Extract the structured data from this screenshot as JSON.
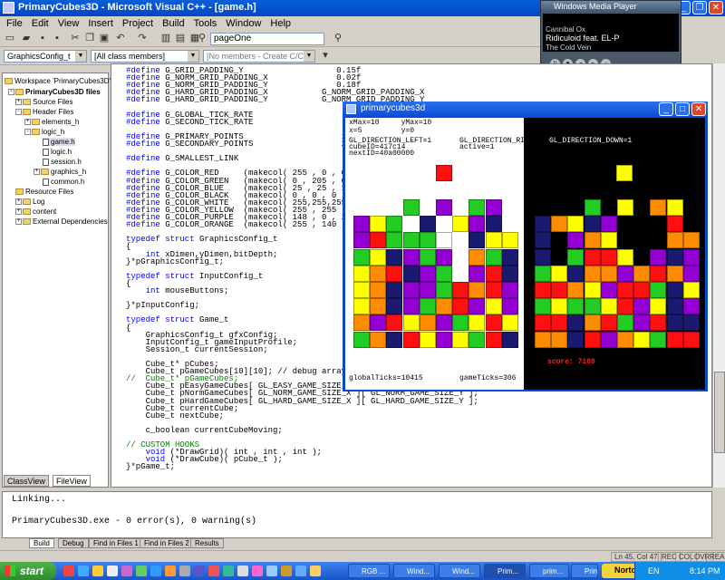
{
  "window": {
    "title": "PrimaryCubes3D - Microsoft Visual C++ - [game.h]"
  },
  "menu": [
    "File",
    "Edit",
    "View",
    "Insert",
    "Project",
    "Build",
    "Tools",
    "Window",
    "Help"
  ],
  "toolbar": {
    "page_combo": "pageOne"
  },
  "toolbar2": {
    "class_combo": "GraphicsConfig_t",
    "members_combo": "[All class members]",
    "function_combo": "[No members - Create C/C++ Member Function..."
  },
  "media_player": {
    "title": "Windows Media Player",
    "line1": "Cannibal Ox",
    "line2": "Ridiculoid feat. EL-P",
    "line3": "The Cold Vein"
  },
  "workspace": {
    "items": [
      {
        "label": "Workspace 'PrimaryCubes3D':",
        "icon": "workspace-icon"
      },
      {
        "label": "PrimaryCubes3D files",
        "icon": "project-icon"
      },
      {
        "label": "Source Files",
        "icon": "folder-icon"
      },
      {
        "label": "Header Files",
        "icon": "folder-icon"
      },
      {
        "label": "elements_h",
        "icon": "folder-icon"
      },
      {
        "label": "logic_h",
        "icon": "folder-icon"
      },
      {
        "label": "game.h",
        "icon": "file-icon"
      },
      {
        "label": "logic.h",
        "icon": "file-icon"
      },
      {
        "label": "session.h",
        "icon": "file-icon"
      },
      {
        "label": "graphics_h",
        "icon": "folder-icon"
      },
      {
        "label": "common.h",
        "icon": "file-icon"
      },
      {
        "label": "Resource Files",
        "icon": "folder-icon"
      },
      {
        "label": "Log",
        "icon": "folder-icon"
      },
      {
        "label": "content",
        "icon": "folder-icon"
      },
      {
        "label": "External Dependencies",
        "icon": "folder-icon"
      }
    ],
    "tabs": [
      "ClassView",
      "FileView"
    ]
  },
  "code_lines": [
    "#define G_GRID_PADDING_Y                   0.15f",
    "#define G_NORM_GRID_PADDING_X              0.02f",
    "#define G_NORM_GRID_PADDING_Y              0.18f",
    "#define G_HARD_GRID_PADDING_X           G_NORM_GRID_PADDING_X",
    "#define G_HARD_GRID_PADDING_Y           G_NORM_GRID_PADDING_Y",
    "",
    "#define G_GLOBAL_TICK_RATE                   60",
    "#define G_SECOND_TICK_RATE                   60",
    "",
    "#define G_PRIMARY_POINTS                    100",
    "#define G_SECONDARY_POINTS                  200",
    "",
    "#define G_SMALLEST_LINK                       5",
    "",
    "#define G_COLOR_RED     (makecol( 255 , 0 , 0 ))",
    "#define G_COLOR_GREEN   (makecol( 0 , 205 , 0 ))",
    "#define G_COLOR_BLUE    (makecol( 25 , 25 , 112 ))",
    "#define G_COLOR_BLACK   (makecol( 0 , 0 , 0 ))",
    "#define G_COLOR_WHITE   (makecol( 255,255,255))",
    "#define G_COLOR_YELLOW  (makecol( 255 , 255 , 0 ))",
    "#define G_COLOR_PURPLE  (makecol( 148 , 0 , 211 ))",
    "#define G_COLOR_ORANGE  (makecol( 255 , 140 , 0 ))",
    "",
    "typedef struct GraphicsConfig_t",
    "{",
    "    int xDimen,yDimen,bitDepth;",
    "}*pGraphicsConfig_t;",
    "",
    "typedef struct InputConfig_t",
    "{",
    "    int mouseButtons;",
    "",
    "}*pInputConfig;",
    "",
    "typedef struct Game_t",
    "{",
    "    GraphicsConfig_t gfxConfig;",
    "    InputConfig_t gameInputProfile;",
    "    Session_t currentSession;",
    "",
    "    Cube_t* pCubes;",
    "    Cube_t pGameCubes[10][10]; // debug array",
    "//  Cube_t* pGameCubes;",
    "    Cube_t pEasyGameCubes[ GL_EASY_GAME_SIZE_X ][ GL_EASY_GAME_SIZE_Y ];",
    "    Cube_t pNormGameCubes[ GL_NORM_GAME_SIZE_X ][ GL_NORM_GAME_SIZE_Y ];",
    "    Cube_t pHardGameCubes[ GL_HARD_GAME_SIZE_X ][ GL_HARD_GAME_SIZE_Y ];",
    "    Cube_t currentCube;",
    "    Cube_t nextCube;",
    "",
    "    c_boolean currentCubeMoving;",
    "",
    "// CUSTOM HOOKS",
    "    void (*DrawGrid)( int , int , int );",
    "    void (*DrawCube)( pCube_t );",
    "}*pGame_t;"
  ],
  "output": {
    "lines": [
      "Linking...",
      "",
      "PrimaryCubes3D.exe - 0 error(s), 0 warning(s)"
    ],
    "tabs": [
      "Build",
      "Debug",
      "Find in Files 1",
      "Find in Files 2",
      "Results"
    ]
  },
  "status": {
    "position": "Ln 45, Col 47",
    "flags": [
      "REC",
      "COL",
      "OVR",
      "READ"
    ]
  },
  "game": {
    "title": "primarycubes3d",
    "left_info": [
      "xMax=10     yMax=10",
      "x=5         y=0",
      "",
      "GL_DIRECTION_LEFT=1",
      "cubeID=417c14",
      "nextID=40a00000"
    ],
    "middle_info": [
      "GL_DIRECTION_RI",
      "active=1"
    ],
    "right_info": "GL_DIRECTION_DOWN=1",
    "global_ticks": "globalTicks=10415",
    "game_ticks": "gameTicks=306",
    "score": "score: 7100",
    "palette": {
      "R": "#ff1010",
      "G": "#22cc22",
      "B": "#1a1a70",
      "Y": "#ffff00",
      "P": "#9400d3",
      "O": "#ff8c00",
      "W": "#ffffff",
      "K": "#000000"
    },
    "left_falling": "R",
    "right_falling": "Y",
    "left_grid": [
      "...G.P.GP.",
      "PYG.B.YPB.",
      "PRGGGW.BYY",
      "GYBPGP.OGB",
      "YORBPG.PRB",
      "YOBPPGRORP",
      "YOBPGORPYP",
      "OPRYOPGYRY",
      "GOBRYPYGRB"
    ],
    "right_grid": [
      "...G.Y.OY.",
      "BOYBPKKKRK",
      "BKPOYKKKOO",
      "BKGRRYKPBP",
      "GYBOOPOROP",
      "RROYPRRGBY",
      "GYGGYRPYBP",
      "RRBORGPRBB",
      "OOBRPOYGRR"
    ]
  },
  "taskbar": {
    "start": "start",
    "tasks": [
      "RGB ...",
      "Wind...",
      "Wind...",
      "Prim...",
      "prim...",
      "Prim..."
    ],
    "lang": "EN",
    "norton": "Norton",
    "time": "8:14 PM"
  }
}
